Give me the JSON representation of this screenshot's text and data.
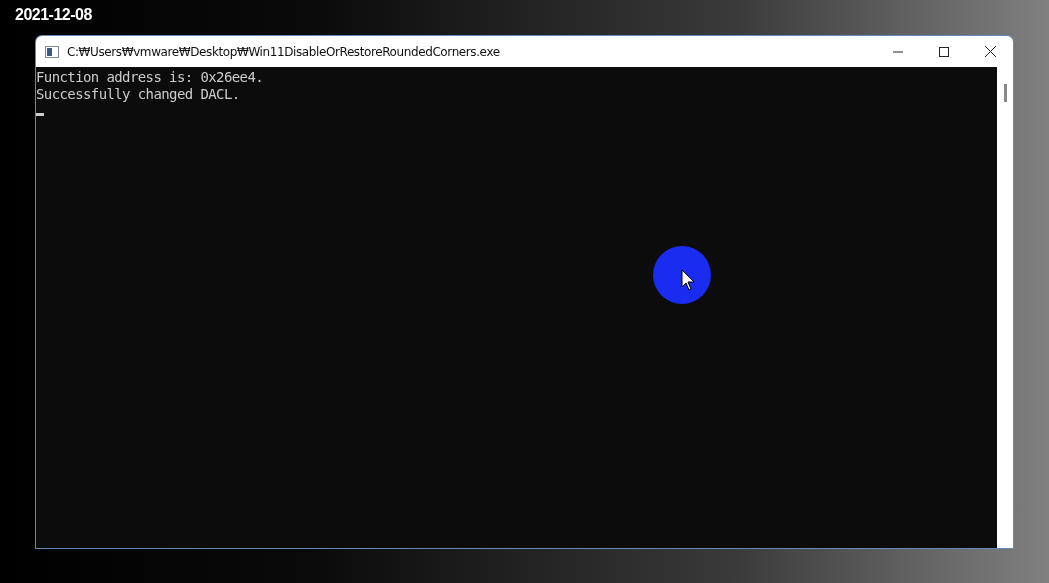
{
  "date": "2021-12-08",
  "window": {
    "title": "C:₩Users₩vmware₩Desktop₩Win11DisableOrRestoreRoundedCorners.exe"
  },
  "console": {
    "lines": [
      "Function address is: 0x26ee4.",
      "Successfully changed DACL."
    ]
  }
}
